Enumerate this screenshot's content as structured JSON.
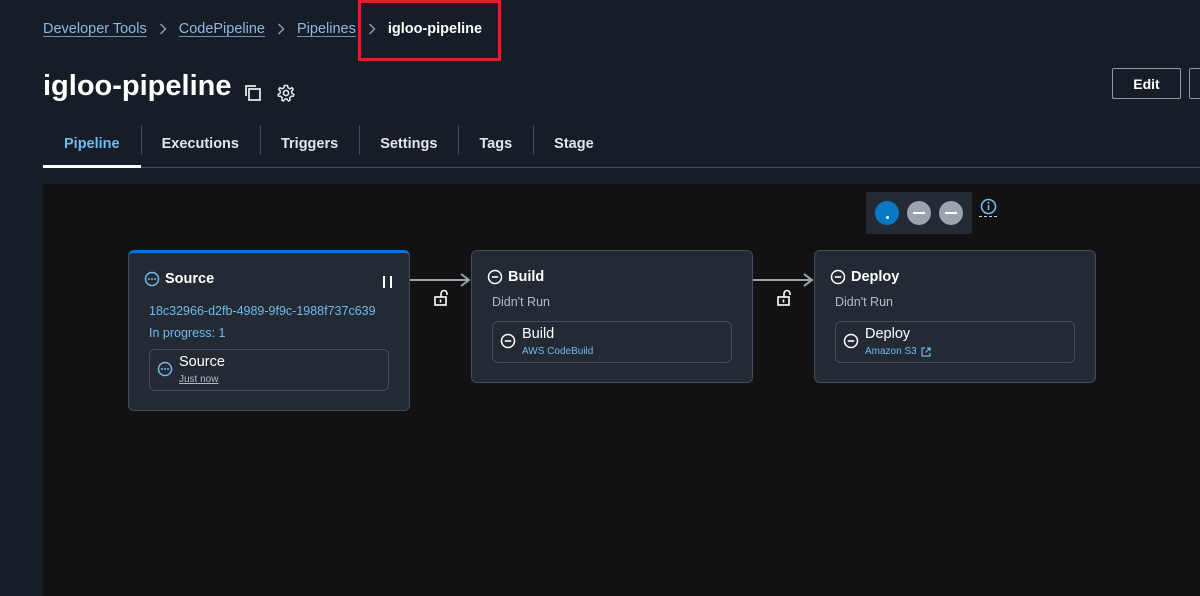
{
  "breadcrumb": {
    "items": [
      "Developer Tools",
      "CodePipeline",
      "Pipelines"
    ],
    "current": "igloo-pipeline"
  },
  "page": {
    "title": "igloo-pipeline",
    "edit_label": "Edit"
  },
  "tabs": [
    "Pipeline",
    "Executions",
    "Triggers",
    "Settings",
    "Tags",
    "Stage"
  ],
  "active_tab": "Pipeline",
  "stages": [
    {
      "name": "Source",
      "status": "in-progress",
      "execution_id": "18c32966-d2fb-4989-9f9c-1988f737c639",
      "progress_text": "In progress: 1",
      "action": {
        "name": "Source",
        "time": "Just now"
      }
    },
    {
      "name": "Build",
      "status": "not-run",
      "status_text": "Didn't Run",
      "action": {
        "name": "Build",
        "provider": "AWS CodeBuild"
      }
    },
    {
      "name": "Deploy",
      "status": "not-run",
      "status_text": "Didn't Run",
      "action": {
        "name": "Deploy",
        "provider": "Amazon S3"
      }
    }
  ],
  "icons": {
    "copy": "copy-icon",
    "settings": "gear-icon",
    "info": "info-icon",
    "lock": "unlock-icon",
    "pause": "pause-icon",
    "external": "external-link-icon"
  },
  "colors": {
    "background": "#161d26",
    "canvas": "#121212",
    "accent": "#0972d3",
    "link": "#6fbbee",
    "highlight": "#e0202a"
  }
}
